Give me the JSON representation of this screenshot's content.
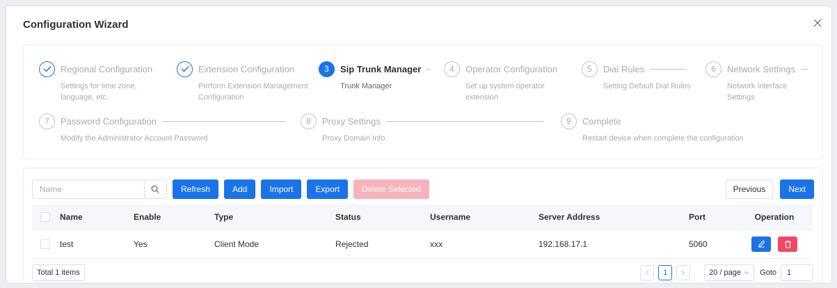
{
  "modal": {
    "title": "Configuration Wizard"
  },
  "steps": [
    {
      "number": "1",
      "title": "Regional Configuration",
      "desc": "Settings for time zone, language, etc.",
      "state": "done"
    },
    {
      "number": "2",
      "title": "Extension Configuration",
      "desc": "Perform Extension Management Configuration",
      "state": "done"
    },
    {
      "number": "3",
      "title": "Sip Trunk Manager",
      "desc": "Trunk Manager",
      "state": "active"
    },
    {
      "number": "4",
      "title": "Operator Configuration",
      "desc": "Set up system operator extension",
      "state": "pending"
    },
    {
      "number": "5",
      "title": "Dial Rules",
      "desc": "Setting Default Dial Rules",
      "state": "pending"
    },
    {
      "number": "6",
      "title": "Network Settings",
      "desc": "Network Interface Settings",
      "state": "pending"
    },
    {
      "number": "7",
      "title": "Password Configuration",
      "desc": "Modify the Administrator Account Password",
      "state": "pending"
    },
    {
      "number": "8",
      "title": "Proxy Settings",
      "desc": "Proxy Domain Info",
      "state": "pending"
    },
    {
      "number": "9",
      "title": "Complete",
      "desc": "Restart device when complete the configuration",
      "state": "pending"
    }
  ],
  "toolbar": {
    "search_placeholder": "Name",
    "refresh": "Refresh",
    "add": "Add",
    "import": "Import",
    "export": "Export",
    "delete_selected": "Delete Selected",
    "previous": "Previous",
    "next": "Next"
  },
  "table": {
    "columns": [
      "Name",
      "Enable",
      "Type",
      "Status",
      "Username",
      "Server Address",
      "Port",
      "Operation"
    ],
    "rows": [
      {
        "name": "test",
        "enable": "Yes",
        "type": "Client Mode",
        "status": "Rejected",
        "username": "xxx",
        "server": "192.168.17.1",
        "port": "5060"
      }
    ]
  },
  "pagination": {
    "total": "Total 1 items",
    "current_page": "1",
    "page_size": "20 / page",
    "goto_label": "Goto",
    "goto_value": "1"
  },
  "colors": {
    "primary": "#1a73e8",
    "danger": "#f04864",
    "disabled": "#f7b3bb"
  },
  "icons": {
    "close": "close-icon",
    "check": "check-icon",
    "search": "search-icon",
    "edit": "edit-icon",
    "delete": "trash-icon"
  }
}
